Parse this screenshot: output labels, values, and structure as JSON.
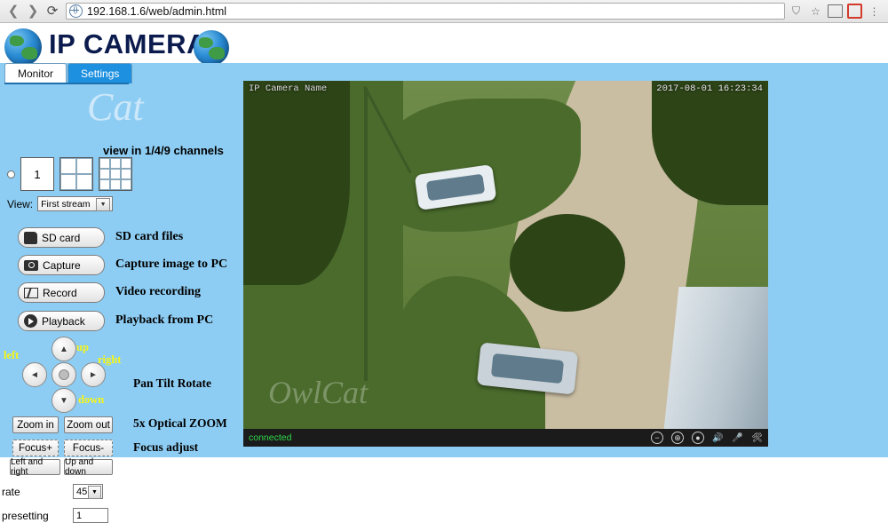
{
  "browser": {
    "url": "192.168.1.6/web/admin.html",
    "back_icon": "back-arrow-icon",
    "forward_icon": "forward-arrow-icon",
    "reload_icon": "reload-icon",
    "bookmark_icon": "bookmark-icon",
    "star_icon": "star-icon",
    "grid_icon": "grid-icon",
    "extension_icon": "extension-icon",
    "menu_icon": "menu-icon"
  },
  "header": {
    "title": "IP CAMERA",
    "logo_left": "globe-logo",
    "logo_right": "globe-logo"
  },
  "tabs": [
    {
      "label": "Monitor",
      "active": true
    },
    {
      "label": "Settings",
      "active": false
    }
  ],
  "watermark": "Cat",
  "annotations": {
    "channels": "view in 1/4/9 channels",
    "sd_card": "SD card files",
    "capture": "Capture image to PC",
    "record": "Video recording",
    "playback": "Playback from PC",
    "ptz": "Pan Tilt Rotate",
    "zoom": "5x Optical ZOOM",
    "focus": "Focus adjust",
    "dir_left": "left",
    "dir_up": "up",
    "dir_right": "right",
    "dir_down": "down"
  },
  "view": {
    "label": "View:",
    "selected": "First stream"
  },
  "channel_buttons": [
    {
      "name": "single-channel",
      "label": "1"
    },
    {
      "name": "quad-channel",
      "label": ""
    },
    {
      "name": "nine-channel",
      "label": ""
    }
  ],
  "buttons": {
    "sd_card": "SD card",
    "capture": "Capture",
    "record": "Record",
    "playback": "Playback",
    "zoom_in": "Zoom in",
    "zoom_out": "Zoom out",
    "focus_plus": "Focus+",
    "focus_minus": "Focus-",
    "left_and_right": "Left and right",
    "up_and_down": "Up and down"
  },
  "ptz_arrows": {
    "up": "▲",
    "down": "▼",
    "left": "◄",
    "right": "►"
  },
  "settings_rows": [
    {
      "label": "rate",
      "value": "45",
      "type": "select"
    },
    {
      "label": "presetting",
      "value": "1",
      "type": "text"
    }
  ],
  "video": {
    "title": "IP Camera Name",
    "timestamp": "2017-08-01 16:23:34",
    "status": "connected",
    "watermark": "OwlCat",
    "controls": [
      {
        "name": "zoom-out-icon",
        "glyph": "−"
      },
      {
        "name": "zoom-reset-icon",
        "glyph": "⊕"
      },
      {
        "name": "record-dot-icon",
        "glyph": "●"
      },
      {
        "name": "volume-icon",
        "glyph": "🔊"
      },
      {
        "name": "mute-mic-icon",
        "glyph": "🎤"
      },
      {
        "name": "settings-tool-icon",
        "glyph": "🛠"
      }
    ]
  },
  "colors": {
    "page_bg": "#8ecdf3",
    "brand": "#0b1b4d",
    "tab_active": "#ffffff",
    "tab_settings": "#1e90e0",
    "status_green": "#2fd84a",
    "annotation_yellow": "#f5f516"
  }
}
